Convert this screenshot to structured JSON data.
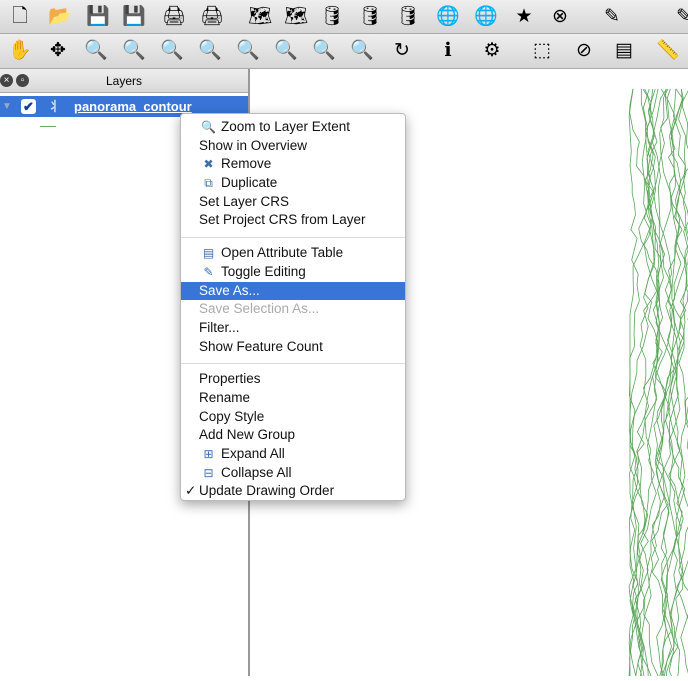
{
  "toolbar1": {
    "icons": [
      "new-project",
      "open-project",
      "save-project",
      "save-project-as",
      "print-composer",
      "print",
      "add-vector-layer",
      "add-raster-layer",
      "add-postgis-layer",
      "add-spatialite-layer",
      "add-mssql-layer",
      "add-wms-layer",
      "add-wfs-layer",
      "new-shapefile-layer",
      "remove-layer",
      "toggle-editing-pencil",
      "edit-pencil"
    ]
  },
  "toolbar2": {
    "icons": [
      "pan",
      "pan-to-selection",
      "zoom-in",
      "zoom-out",
      "zoom-native",
      "zoom-full",
      "zoom-to-selection",
      "zoom-to-layer",
      "zoom-last",
      "zoom-next",
      "refresh",
      "identify",
      "action",
      "select-features",
      "deselect",
      "attribute-table",
      "measure"
    ]
  },
  "layers_panel": {
    "title": "Layers",
    "layer": {
      "name": "panorama_contour",
      "checked": true
    }
  },
  "context_menu": {
    "items": [
      {
        "label": "Zoom to Layer Extent",
        "icon": "zoom-icon"
      },
      {
        "label": "Show in Overview"
      },
      {
        "label": "Remove",
        "icon": "remove-icon"
      },
      {
        "label": "Duplicate",
        "icon": "duplicate-icon"
      },
      {
        "label": "Set Layer CRS"
      },
      {
        "label": "Set Project CRS from Layer"
      },
      {
        "label": "Open Attribute Table",
        "icon": "table-icon"
      },
      {
        "label": "Toggle Editing",
        "icon": "pencil-icon"
      },
      {
        "label": "Save As...",
        "highlighted": true
      },
      {
        "label": "Save Selection As...",
        "disabled": true
      },
      {
        "label": "Filter..."
      },
      {
        "label": "Show Feature Count"
      },
      {
        "label": "Properties"
      },
      {
        "label": "Rename"
      },
      {
        "label": "Copy Style"
      },
      {
        "label": "Add New Group"
      },
      {
        "label": "Expand All",
        "icon": "expand-icon"
      },
      {
        "label": "Collapse All",
        "icon": "collapse-icon"
      },
      {
        "label": "Update Drawing Order",
        "checked": true
      }
    ]
  },
  "colors": {
    "highlight": "#3875d7",
    "contour": "#5aa55a"
  }
}
